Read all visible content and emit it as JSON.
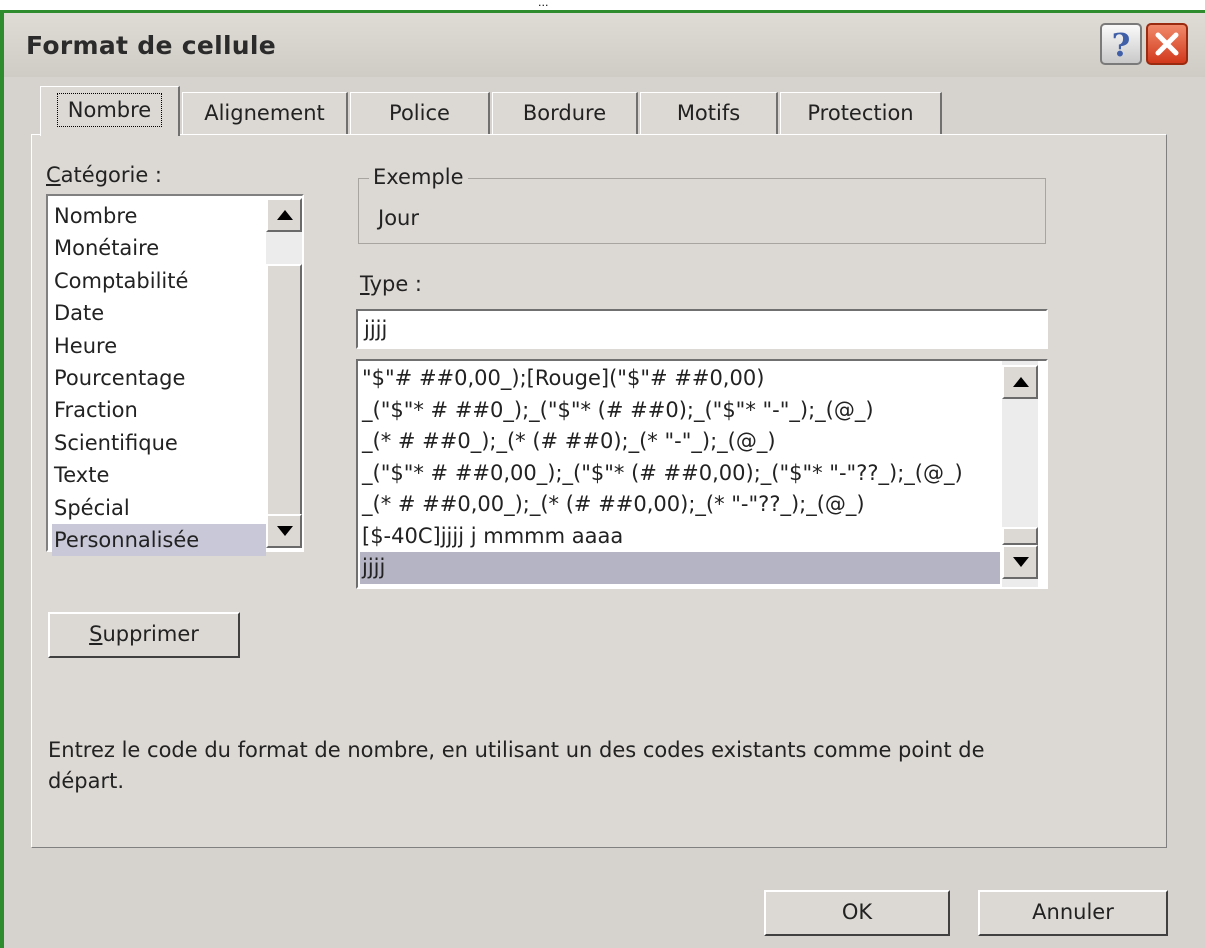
{
  "above_text": "...",
  "dialog": {
    "title": "Format de cellule",
    "help_label": "?"
  },
  "tabs": [
    "Nombre",
    "Alignement",
    "Police",
    "Bordure",
    "Motifs",
    "Protection"
  ],
  "category": {
    "label_first": "C",
    "label_rest": "atégorie :",
    "items": [
      "Nombre",
      "Monétaire",
      "Comptabilité",
      "Date",
      "Heure",
      "Pourcentage",
      "Fraction",
      "Scientifique",
      "Texte",
      "Spécial",
      "Personnalisée"
    ],
    "selected": "Personnalisée"
  },
  "example": {
    "legend": "Exemple",
    "value": "Jour"
  },
  "type": {
    "label_first": "T",
    "label_rest": "ype :",
    "value": "jjjj",
    "formats": [
      "\"$\"# ##0,00_);[Rouge](\"$\"# ##0,00)",
      "_(\"$\"* # ##0_);_(\"$\"* (# ##0);_(\"$\"* \"-\"_);_(@_)",
      "_(* # ##0_);_(* (# ##0);_(* \"-\"_);_(@_)",
      "_(\"$\"* # ##0,00_);_(\"$\"* (# ##0,00);_(\"$\"* \"-\"??_);_(@_)",
      "_(* # ##0,00_);_(* (# ##0,00);_(* \"-\"??_);_(@_)",
      "[$-40C]jjjj j mmmm aaaa",
      "jjjj"
    ],
    "selected": "jjjj"
  },
  "delete_button": {
    "first": "S",
    "rest": "upprimer"
  },
  "description": "Entrez le code du format de nombre, en utilisant un des codes existants comme point de départ.",
  "ok_label": "OK",
  "cancel_label": "Annuler",
  "colors": {
    "frame": "#2e8b2e",
    "face": "#d6d3ce",
    "selection": "#c8c8d8",
    "close": "#d2381c"
  }
}
